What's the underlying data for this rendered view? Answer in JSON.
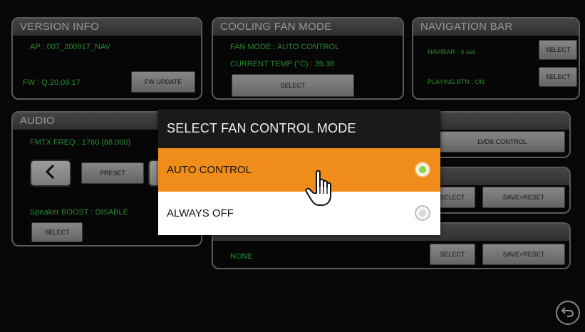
{
  "panels": {
    "version": {
      "title": "VERSION INFO",
      "ap": "AP : 007_200917_NAV",
      "fw": "FW : Q.20.09.17",
      "fw_button": "FW UPDATE"
    },
    "cooling": {
      "title": "COOLING FAN MODE",
      "mode": "FAN MODE : AUTO CONTROL",
      "temp": "CURRENT TEMP (°C) : 39.38",
      "select_button": "SELECT"
    },
    "navbar": {
      "title": "NAVIGATION BAR",
      "navibar": "NAVIBAR : 4 sec",
      "playing": "PLAYING BTN : ON",
      "select1": "SELECT",
      "select2": "SELECT"
    },
    "audio": {
      "title": "AUDIO",
      "fmtx": "FMTX FREQ : 1760 (88.000)",
      "preset": "PRESET",
      "speaker": "Speaker BOOST : DISABLE",
      "select_button": "SELECT"
    },
    "display": {
      "lvds_button": "LVDS CONTROL"
    },
    "row2": {
      "select": "SELECT",
      "save_reset": "SAVE>RESET"
    },
    "row3": {
      "value": "NONE",
      "select": "SELECT",
      "save_reset": "SAVE>RESET"
    }
  },
  "dialog": {
    "title": "SELECT FAN CONTROL MODE",
    "options": [
      {
        "label": "AUTO CONTROL",
        "selected": true
      },
      {
        "label": "ALWAYS OFF",
        "selected": false
      }
    ]
  },
  "colors": {
    "accent": "#f08c1a",
    "status_green": "#3fd14a",
    "radio_selected": "#8bd14a"
  },
  "icons": {
    "prev": "chevron-left-icon",
    "pointer": "hand-pointer-icon",
    "back": "back-arrow-icon"
  }
}
